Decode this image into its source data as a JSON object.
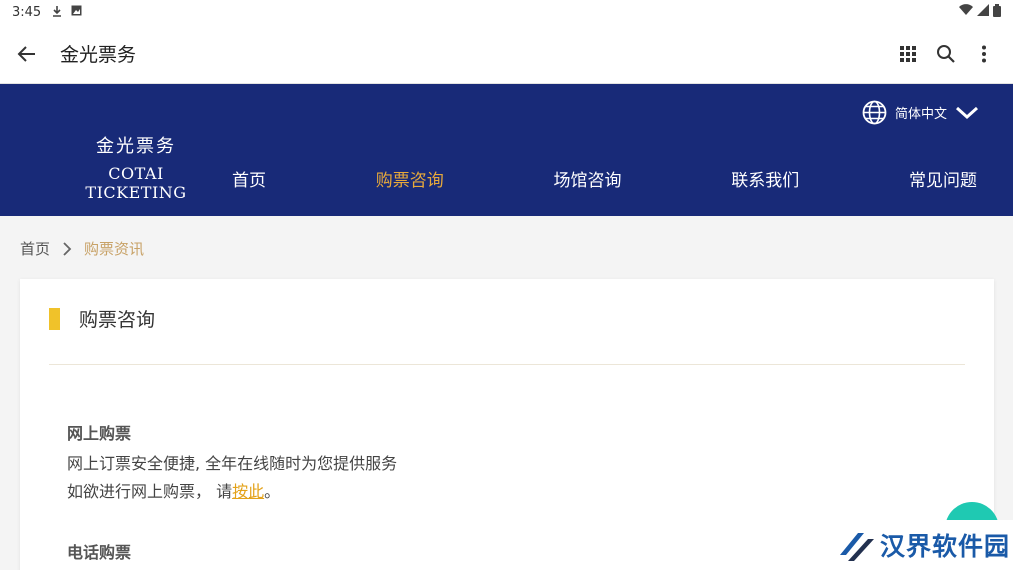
{
  "status_bar": {
    "time": "3:45"
  },
  "app_bar": {
    "title": "金光票务"
  },
  "site_header": {
    "brand_cn": "金光票务",
    "brand_en": "COTAI TICKETING",
    "language": "简体中文",
    "nav": [
      {
        "label": "首页",
        "active": false
      },
      {
        "label": "购票咨询",
        "active": true
      },
      {
        "label": "场馆咨询",
        "active": false
      },
      {
        "label": "联系我们",
        "active": false
      },
      {
        "label": "常见问题",
        "active": false
      }
    ]
  },
  "breadcrumb": {
    "home": "首页",
    "current": "购票资讯"
  },
  "card": {
    "heading": "购票咨询",
    "sections": [
      {
        "title": "网上购票",
        "line1": "网上订票安全便捷, 全年在线随时为您提供服务",
        "line2_prefix": "如欲进行网上购票， 请",
        "line2_link": "按此",
        "line2_suffix": "。"
      },
      {
        "title": "电话购票"
      }
    ]
  },
  "watermark": {
    "text": "汉界软件园"
  },
  "colors": {
    "header_bg": "#182a78",
    "nav_active": "#e7a93b",
    "breadcrumb_current": "#c8a267",
    "accent_bar": "#f0c22a",
    "link": "#e3a21a",
    "fab": "#1fc9b2"
  }
}
